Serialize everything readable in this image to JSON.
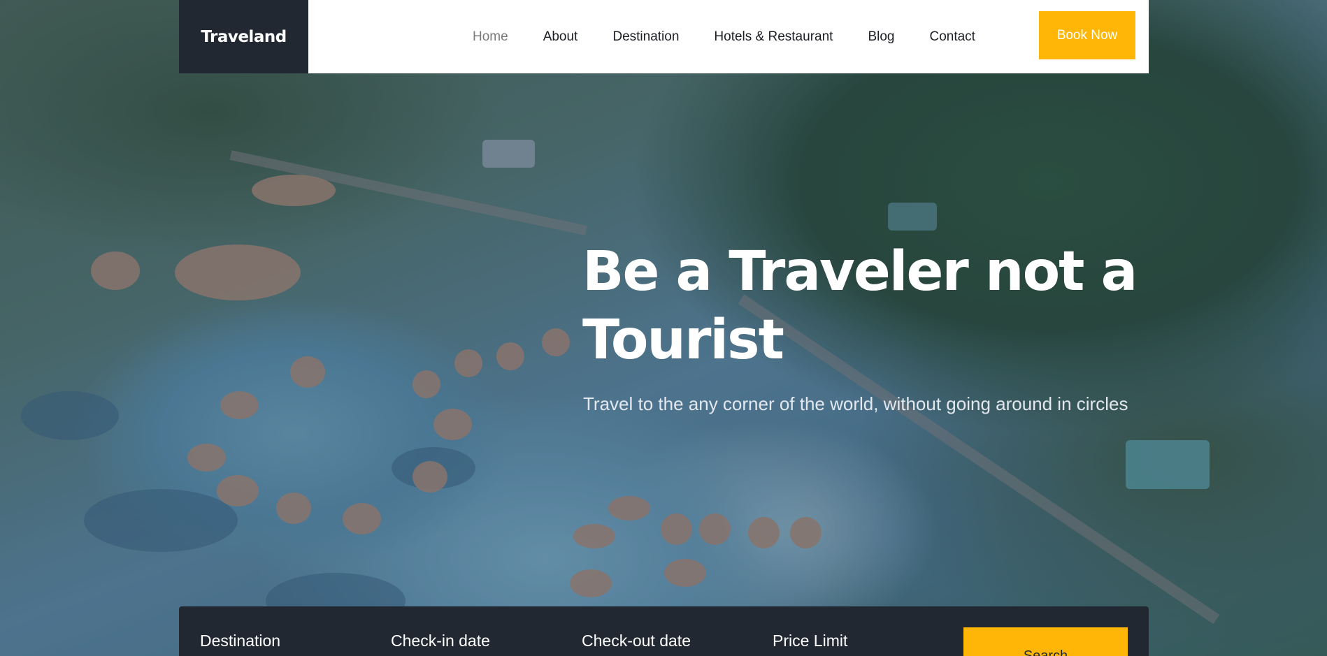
{
  "brand": {
    "name": "Traveland"
  },
  "nav": {
    "items": [
      {
        "label": "Home",
        "active": true
      },
      {
        "label": "About"
      },
      {
        "label": "Destination"
      },
      {
        "label": "Hotels & Restaurant"
      },
      {
        "label": "Blog"
      },
      {
        "label": "Contact"
      }
    ],
    "book_label": "Book Now"
  },
  "hero": {
    "title": "Be a Traveler not a Tourist",
    "subtitle": "Travel to the any corner of the world, without going around in circles"
  },
  "search": {
    "fields": [
      {
        "label": "Destination"
      },
      {
        "label": "Check-in date"
      },
      {
        "label": "Check-out date"
      },
      {
        "label": "Price Limit"
      }
    ],
    "button_label": "Search"
  },
  "colors": {
    "accent": "#ffb606",
    "dark": "#222831",
    "header_bg": "#ffffff"
  }
}
